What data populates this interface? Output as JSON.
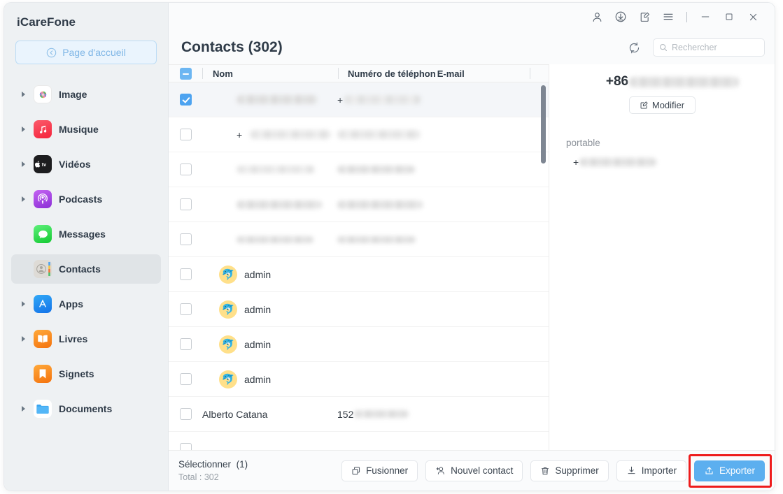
{
  "app": {
    "brand": "iCareFone",
    "home_button": "Page d'accueil"
  },
  "sidebar": {
    "items": [
      {
        "label": "Image",
        "icon": "photos-icon",
        "expandable": true,
        "active": false
      },
      {
        "label": "Musique",
        "icon": "music-icon",
        "expandable": true,
        "active": false
      },
      {
        "label": "Vidéos",
        "icon": "appletv-icon",
        "expandable": true,
        "active": false
      },
      {
        "label": "Podcasts",
        "icon": "podcasts-icon",
        "expandable": true,
        "active": false
      },
      {
        "label": "Messages",
        "icon": "messages-icon",
        "expandable": false,
        "active": false
      },
      {
        "label": "Contacts",
        "icon": "contacts-icon",
        "expandable": false,
        "active": true
      },
      {
        "label": "Apps",
        "icon": "appstore-icon",
        "expandable": true,
        "active": false
      },
      {
        "label": "Livres",
        "icon": "books-icon",
        "expandable": true,
        "active": false
      },
      {
        "label": "Signets",
        "icon": "bookmark-icon",
        "expandable": false,
        "active": false
      },
      {
        "label": "Documents",
        "icon": "folder-icon",
        "expandable": true,
        "active": false
      }
    ]
  },
  "titlebar": {
    "icons": [
      "account-icon",
      "download-icon",
      "feedback-icon",
      "menu-icon"
    ],
    "minimize": "−",
    "maximize": "□",
    "close": "×"
  },
  "header": {
    "title": "Contacts (302)",
    "refresh_icon": "refresh-icon",
    "search": {
      "placeholder": "Rechercher",
      "value": ""
    }
  },
  "table": {
    "columns": [
      "Nom",
      "Numéro de téléphon",
      "E-mail"
    ],
    "header_checkbox_state": "indeterminate",
    "rows": [
      {
        "checked": true,
        "name": "",
        "name_redacted": true,
        "name_prefix": "",
        "phone": "",
        "phone_redacted": true,
        "phone_prefix": "+",
        "avatar": false
      },
      {
        "checked": false,
        "name": "",
        "name_redacted": true,
        "name_prefix": "+",
        "phone": "",
        "phone_redacted": true,
        "phone_prefix": "",
        "avatar": false
      },
      {
        "checked": false,
        "name": "",
        "name_redacted": true,
        "name_prefix": "",
        "phone": "",
        "phone_redacted": true,
        "phone_prefix": "",
        "avatar": false
      },
      {
        "checked": false,
        "name": "",
        "name_redacted": true,
        "name_prefix": "",
        "phone": "",
        "phone_redacted": true,
        "phone_prefix": "",
        "avatar": false
      },
      {
        "checked": false,
        "name": "",
        "name_redacted": true,
        "name_prefix": "",
        "phone": "",
        "phone_redacted": true,
        "phone_prefix": "",
        "avatar": false
      },
      {
        "checked": false,
        "name": "admin",
        "name_redacted": false,
        "name_prefix": "",
        "phone": "",
        "phone_redacted": false,
        "phone_prefix": "",
        "avatar": true
      },
      {
        "checked": false,
        "name": "admin",
        "name_redacted": false,
        "name_prefix": "",
        "phone": "",
        "phone_redacted": false,
        "phone_prefix": "",
        "avatar": true
      },
      {
        "checked": false,
        "name": "admin",
        "name_redacted": false,
        "name_prefix": "",
        "phone": "",
        "phone_redacted": false,
        "phone_prefix": "",
        "avatar": true
      },
      {
        "checked": false,
        "name": "admin",
        "name_redacted": false,
        "name_prefix": "",
        "phone": "",
        "phone_redacted": false,
        "phone_prefix": "",
        "avatar": true
      },
      {
        "checked": false,
        "name": "Alberto Catana",
        "name_redacted": false,
        "name_prefix": "",
        "phone": "152",
        "phone_redacted": true,
        "phone_prefix": "",
        "avatar": false
      }
    ]
  },
  "detail": {
    "phone_prefix": "+86",
    "phone_redacted": true,
    "edit_button": "Modifier",
    "section_label": "portable",
    "value_prefix": "+",
    "value_redacted": true
  },
  "footer": {
    "selected_label": "Sélectionner",
    "selected_count": "(1)",
    "total_label": "Total : 302",
    "buttons": [
      {
        "label": "Fusionner",
        "icon": "merge-icon",
        "primary": false
      },
      {
        "label": "Nouvel contact",
        "icon": "add-user-icon",
        "primary": false
      },
      {
        "label": "Supprimer",
        "icon": "trash-icon",
        "primary": false
      },
      {
        "label": "Importer",
        "icon": "import-icon",
        "primary": false
      },
      {
        "label": "Exporter",
        "icon": "export-icon",
        "primary": true
      }
    ]
  },
  "colors": {
    "accent": "#5cafef",
    "highlight_box": "#ee1c1c",
    "sidebar_bg": "#eef1f3",
    "selected_row": "#f4f6f9"
  }
}
